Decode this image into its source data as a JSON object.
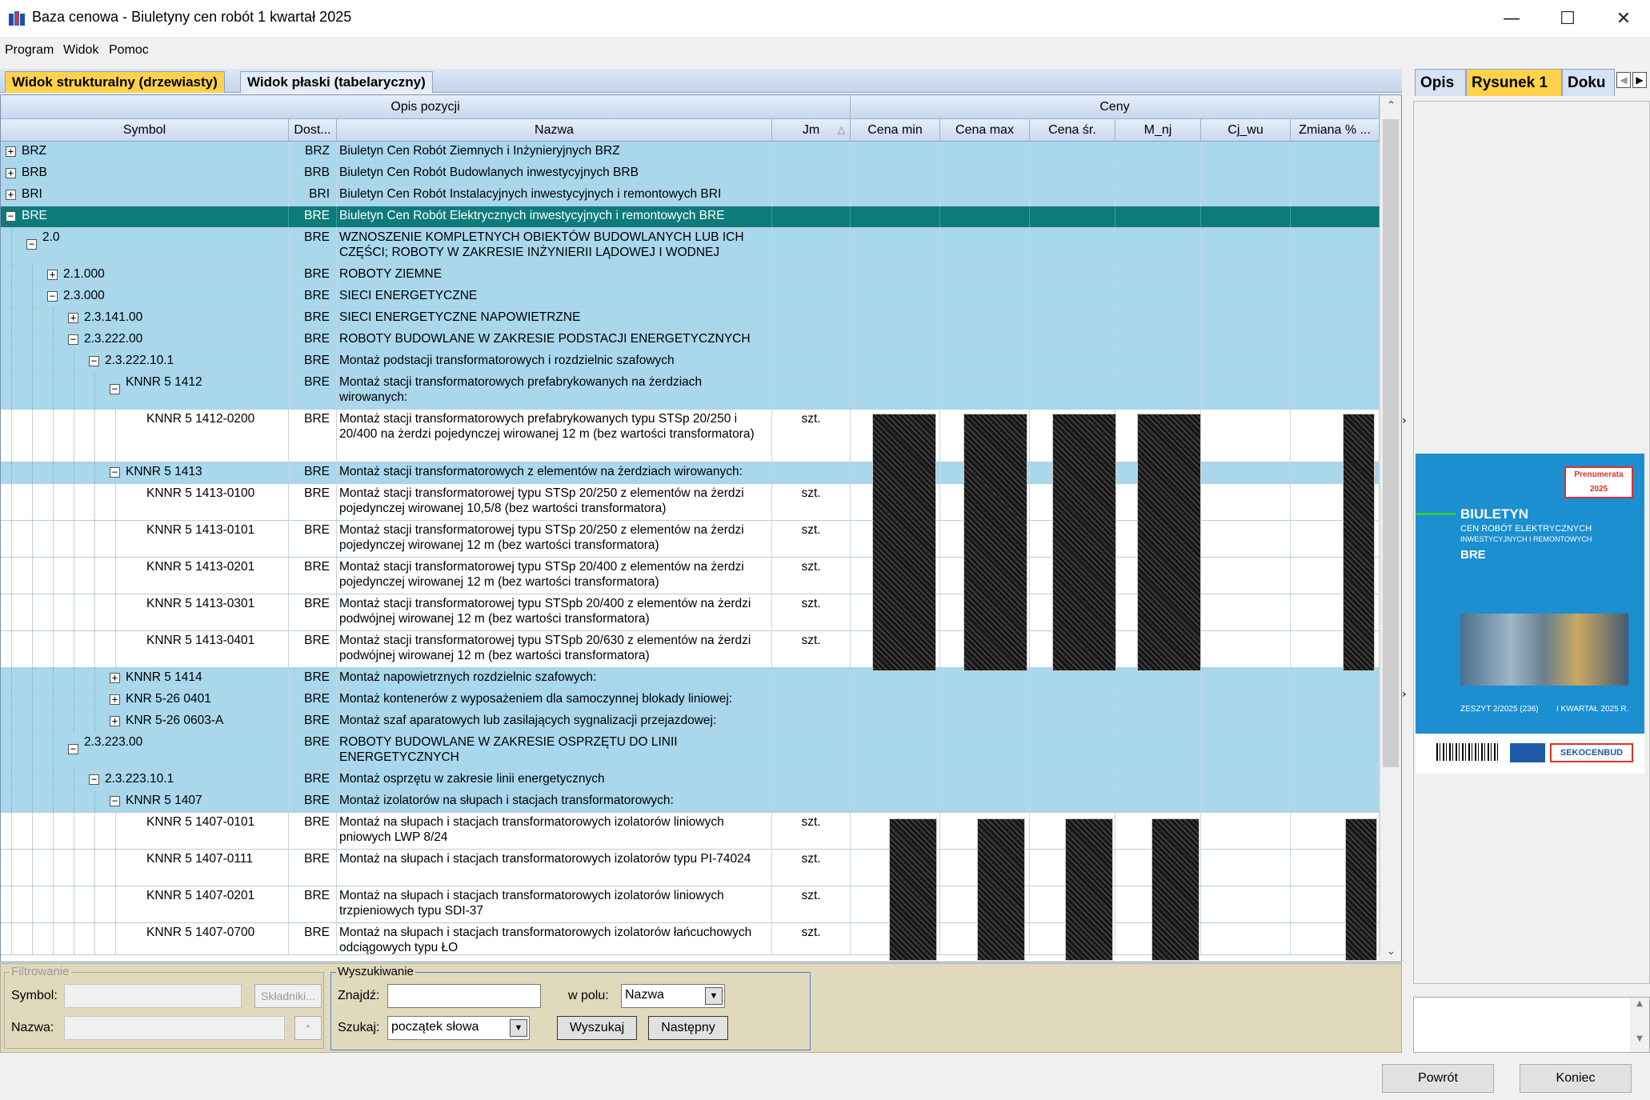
{
  "window": {
    "title": "Baza cenowa - Biuletyny cen robót 1 kwartał 2025",
    "minimize": "—",
    "maximize": "☐",
    "close": "✕"
  },
  "menu": [
    "Program",
    "Widok",
    "Pomoc"
  ],
  "tabs": {
    "structural": "Widok strukturalny (drzewiasty)",
    "flat": "Widok płaski (tabelaryczny)"
  },
  "grid": {
    "group_headers": {
      "opis": "Opis pozycji",
      "ceny": "Ceny"
    },
    "columns": [
      "Symbol",
      "Dost...",
      "Nazwa",
      "Jm",
      "Cena min",
      "Cena max",
      "Cena śr.",
      "M_nj",
      "Cj_wu",
      "Zmiana % ..."
    ],
    "rows": [
      {
        "symbol": "BRZ",
        "dost": "BRZ",
        "name": "Biuletyn Cen Robót Ziemnych i Inżynieryjnych BRZ",
        "jm": "",
        "toggle": "+"
      },
      {
        "symbol": "BRB",
        "dost": "BRB",
        "name": "Biuletyn Cen Robót Budowlanych inwestycyjnych BRB",
        "jm": "",
        "toggle": "+"
      },
      {
        "symbol": "BRI",
        "dost": "BRI",
        "name": "Biuletyn Cen Robót Instalacyjnych inwestycyjnych i remontowych BRI",
        "jm": "",
        "toggle": "+"
      },
      {
        "symbol": "BRE",
        "dost": "BRE",
        "name": "Biuletyn Cen Robót Elektrycznych inwestycyjnych i remontowych BRE",
        "jm": "",
        "toggle": "−"
      },
      {
        "symbol": "2.0",
        "dost": "BRE",
        "name": "WZNOSZENIE KOMPLETNYCH OBIEKTÓW BUDOWLANYCH LUB ICH CZĘŚCI; ROBOTY W ZAKRESIE INŻYNIERII LĄDOWEJ I WODNEJ",
        "jm": "",
        "toggle": "−"
      },
      {
        "symbol": "2.1.000",
        "dost": "BRE",
        "name": "ROBOTY ZIEMNE",
        "jm": "",
        "toggle": "+"
      },
      {
        "symbol": "2.3.000",
        "dost": "BRE",
        "name": "SIECI ENERGETYCZNE",
        "jm": "",
        "toggle": "−"
      },
      {
        "symbol": "2.3.141.00",
        "dost": "BRE",
        "name": "SIECI ENERGETYCZNE NAPOWIETRZNE",
        "jm": "",
        "toggle": "+"
      },
      {
        "symbol": "2.3.222.00",
        "dost": "BRE",
        "name": "ROBOTY BUDOWLANE W ZAKRESIE PODSTACJI ENERGETYCZNYCH",
        "jm": "",
        "toggle": "−"
      },
      {
        "symbol": "2.3.222.10.1",
        "dost": "BRE",
        "name": "Montaż podstacji transformatorowych i rozdzielnic szafowych",
        "jm": "",
        "toggle": "−"
      },
      {
        "symbol": "KNNR 5 1412",
        "dost": "BRE",
        "name": "Montaż stacji transformatorowych prefabrykowanych na żerdziach wirowanych:",
        "jm": "",
        "toggle": "−"
      },
      {
        "symbol": "KNNR 5 1412-0200",
        "dost": "BRE",
        "name": "Montaż stacji transformatorowych prefabrykowanych typu STSp 20/250 i 20/400 na żerdzi pojedynczej wirowanej 12 m (bez wartości transformatora)",
        "jm": "szt.",
        "toggle": ""
      },
      {
        "symbol": "KNNR 5 1413",
        "dost": "BRE",
        "name": "Montaż stacji transformatorowych z elementów na żerdziach wirowanych:",
        "jm": "",
        "toggle": "−"
      },
      {
        "symbol": "KNNR 5 1413-0100",
        "dost": "BRE",
        "name": "Montaż stacji transformatorowej typu STSp 20/250 z elementów na żerdzi pojedynczej wirowanej 10,5/8 (bez wartości transformatora)",
        "jm": "szt.",
        "toggle": ""
      },
      {
        "symbol": "KNNR 5 1413-0101",
        "dost": "BRE",
        "name": "Montaż stacji transformatorowej typu STSp 20/250 z elementów na żerdzi pojedynczej wirowanej 12 m (bez wartości transformatora)",
        "jm": "szt.",
        "toggle": ""
      },
      {
        "symbol": "KNNR 5 1413-0201",
        "dost": "BRE",
        "name": "Montaż stacji transformatorowej typu STSp 20/400 z elementów na żerdzi pojedynczej wirowanej 12 m (bez wartości transformatora)",
        "jm": "szt.",
        "toggle": ""
      },
      {
        "symbol": "KNNR 5 1413-0301",
        "dost": "BRE",
        "name": "Montaż stacji transformatorowej typu STSpb 20/400 z elementów na żerdzi podwójnej wirowanej 12 m (bez wartości transformatora)",
        "jm": "szt.",
        "toggle": ""
      },
      {
        "symbol": "KNNR 5 1413-0401",
        "dost": "BRE",
        "name": "Montaż stacji transformatorowej typu STSpb 20/630 z elementów na żerdzi podwójnej wirowanej 12 m (bez wartości transformatora)",
        "jm": "szt.",
        "toggle": ""
      },
      {
        "symbol": "KNNR 5 1414",
        "dost": "BRE",
        "name": "Montaż napowietrznych rozdzielnic szafowych:",
        "jm": "",
        "toggle": "+"
      },
      {
        "symbol": "KNR 5-26 0401",
        "dost": "BRE",
        "name": "Montaż kontenerów z wyposażeniem dla samoczynnej blokady liniowej:",
        "jm": "",
        "toggle": "+"
      },
      {
        "symbol": "KNR 5-26 0603-A",
        "dost": "BRE",
        "name": "Montaż szaf aparatowych lub zasilających sygnalizacji przejazdowej:",
        "jm": "",
        "toggle": "+"
      },
      {
        "symbol": "2.3.223.00",
        "dost": "BRE",
        "name": "ROBOTY BUDOWLANE W ZAKRESIE OSPRZĘTU DO LINII ENERGETYCZNYCH",
        "jm": "",
        "toggle": "−"
      },
      {
        "symbol": "2.3.223.10.1",
        "dost": "BRE",
        "name": "Montaż osprzętu w zakresie linii energetycznych",
        "jm": "",
        "toggle": "−"
      },
      {
        "symbol": "KNNR 5 1407",
        "dost": "BRE",
        "name": "Montaż izolatorów na słupach i stacjach transformatorowych:",
        "jm": "",
        "toggle": "−"
      },
      {
        "symbol": "KNNR 5 1407-0101",
        "dost": "BRE",
        "name": "Montaż na słupach i stacjach transformatorowych izolatorów liniowych pniowych LWP 8/24",
        "jm": "szt.",
        "toggle": ""
      },
      {
        "symbol": "KNNR 5 1407-0111",
        "dost": "BRE",
        "name": "Montaż na słupach i stacjach transformatorowych izolatorów typu PI-74024",
        "jm": "szt.",
        "toggle": ""
      },
      {
        "symbol": "KNNR 5 1407-0201",
        "dost": "BRE",
        "name": "Montaż na słupach i stacjach transformatorowych izolatorów liniowych trzpieniowych typu SDI-37",
        "jm": "szt.",
        "toggle": ""
      },
      {
        "symbol": "KNNR 5 1407-0700",
        "dost": "BRE",
        "name": "Montaż na słupach i stacjach transformatorowych izolatorów łańcuchowych odciągowych typu ŁO",
        "jm": "szt.",
        "toggle": ""
      }
    ]
  },
  "filter": {
    "legend": "Filtrowanie",
    "symbol_label": "Symbol:",
    "name_label": "Nazwa:",
    "components_button": "Składniki...",
    "small_button": "*"
  },
  "search": {
    "legend": "Wyszukiwanie",
    "find_label": "Znajdź:",
    "find_value": "",
    "field_label": "w polu:",
    "field_value": "Nazwa",
    "mode_label": "Szukaj:",
    "mode_value": "początek słowa",
    "search_button": "Wyszukaj",
    "next_button": "Następny"
  },
  "right_panel": {
    "tabs": [
      "Opis",
      "Rysunek 1",
      "Doku"
    ],
    "cover": {
      "title": "BIULETYN",
      "line1": "CEN ROBÓT ELEKTRYCZNYCH",
      "line2": "INWESTYCYJNYCH I REMONTOWYCH",
      "code": "BRE",
      "issue": "ZESZYT 2/2025 (236)",
      "quarter": "I KWARTAŁ 2025 R.",
      "badge": "Prenumerata 2025",
      "publisher": "SEKOCENBUD"
    }
  },
  "footer": {
    "back_button": "Powrót",
    "end_button": "Koniec"
  }
}
